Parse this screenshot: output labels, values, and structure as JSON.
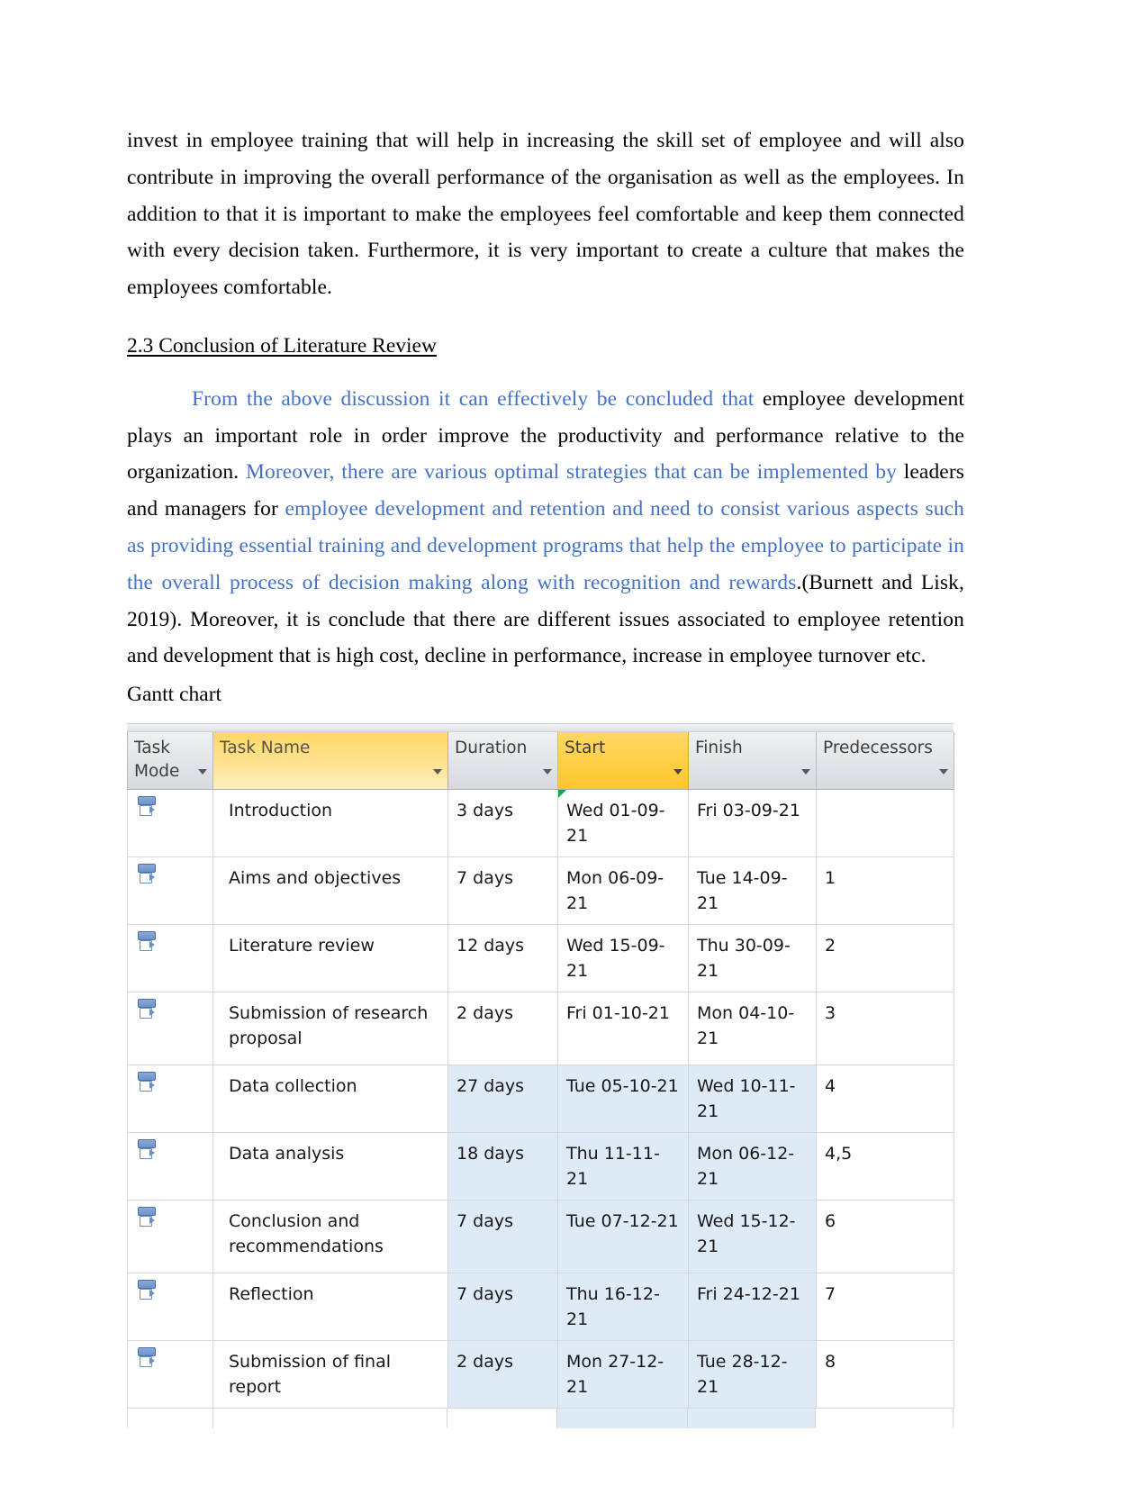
{
  "document": {
    "paragraph_1": {
      "text": "invest in employee training that will help in increasing the skill set of employee and will also contribute in improving the overall performance of the organisation as well as the employees. In addition to that it is important to make the employees feel comfortable and keep them connected with every decision taken. Furthermore, it is very important to create a culture that makes the employees comfortable."
    },
    "heading": "2.3 Conclusion of Literature Review ",
    "paragraph_2": {
      "seg_1_blue": "From the above discussion it can effectively be concluded that ",
      "seg_2_black": "employee development plays an important role in order improve the productivity and performance relative to the organization. ",
      "seg_3_blue": "Moreover, there are various optimal strategies that can be implemented by ",
      "seg_4_black": "leaders and managers for ",
      "seg_5_blue": "employee development and retention and need to consist various aspects such as providing essential training and development programs that help the employee to participate in the overall process of decision making along with recognition and rewards",
      "seg_6_black": ".(Burnett and Lisk, 2019). Moreover, it is conclude that there are different issues associated to employee retention and development that is high cost, decline in performance, increase in employee turnover etc."
    },
    "gantt_label": "Gantt chart"
  },
  "colors": {
    "blue_text": "#4472c4",
    "header_grey": "#e3e5e9",
    "header_yellow_light": "#ffe08a",
    "header_yellow_strong": "#ffd14b",
    "selection_blue": "#dfeaf7",
    "flag_green": "#17a84a"
  },
  "project_table": {
    "columns": [
      {
        "key": "task_mode",
        "label": "Task Mode",
        "label_line1": "Task",
        "label_line2": "Mode",
        "highlight": "none",
        "has_filter": true
      },
      {
        "key": "task_name",
        "label": "Task Name",
        "highlight": "light",
        "has_filter": true
      },
      {
        "key": "duration",
        "label": "Duration",
        "highlight": "none",
        "has_filter": true
      },
      {
        "key": "start",
        "label": "Start",
        "highlight": "strong",
        "has_filter": true
      },
      {
        "key": "finish",
        "label": "Finish",
        "highlight": "none",
        "has_filter": true
      },
      {
        "key": "predecessors",
        "label": "Predecessors",
        "highlight": "none",
        "has_filter": true
      }
    ],
    "rows": [
      {
        "mode_icon": "manually-scheduled-icon",
        "task_name": "Introduction",
        "duration": "3 days",
        "start": "Wed 01-09-21",
        "finish": "Fri 03-09-21",
        "predecessors": "",
        "selected": false,
        "start_flag": true,
        "two_line": false
      },
      {
        "mode_icon": "manually-scheduled-icon",
        "task_name": "Aims and objectives",
        "duration": "7 days",
        "start": "Mon 06-09-21",
        "finish": "Tue 14-09-21",
        "predecessors": "1",
        "selected": false,
        "start_flag": false,
        "two_line": false
      },
      {
        "mode_icon": "manually-scheduled-icon",
        "task_name": "Literature review",
        "duration": "12 days",
        "start": "Wed 15-09-21",
        "finish": "Thu 30-09-21",
        "predecessors": "2",
        "selected": false,
        "start_flag": false,
        "two_line": false
      },
      {
        "mode_icon": "manually-scheduled-icon",
        "task_name": "Submission of research proposal",
        "duration": "2 days",
        "start": "Fri 01-10-21",
        "finish": "Mon 04-10-21",
        "predecessors": "3",
        "selected": false,
        "start_flag": false,
        "two_line": true
      },
      {
        "mode_icon": "manually-scheduled-icon",
        "task_name": "Data collection",
        "duration": "27 days",
        "start": "Tue 05-10-21",
        "finish": "Wed 10-11-21",
        "predecessors": "4",
        "selected": true,
        "start_flag": false,
        "two_line": false
      },
      {
        "mode_icon": "manually-scheduled-icon",
        "task_name": "Data analysis",
        "duration": "18 days",
        "start": "Thu 11-11-21",
        "finish": "Mon 06-12-21",
        "predecessors": "4,5",
        "selected": true,
        "start_flag": false,
        "two_line": false
      },
      {
        "mode_icon": "manually-scheduled-icon",
        "task_name": "Conclusion and recommendations",
        "duration": "7 days",
        "start": "Tue 07-12-21",
        "finish": "Wed 15-12-21",
        "predecessors": "6",
        "selected": true,
        "start_flag": false,
        "two_line": true
      },
      {
        "mode_icon": "manually-scheduled-icon",
        "task_name": "Reflection",
        "duration": "7 days",
        "start": "Thu 16-12-21",
        "finish": "Fri 24-12-21",
        "predecessors": "7",
        "selected": true,
        "start_flag": false,
        "two_line": false
      },
      {
        "mode_icon": "manually-scheduled-icon",
        "task_name": "Submission of final report",
        "duration": "2 days",
        "start": "Mon 27-12-21",
        "finish": "Tue 28-12-21",
        "predecessors": "8",
        "selected": true,
        "start_flag": false,
        "two_line": false
      }
    ]
  }
}
